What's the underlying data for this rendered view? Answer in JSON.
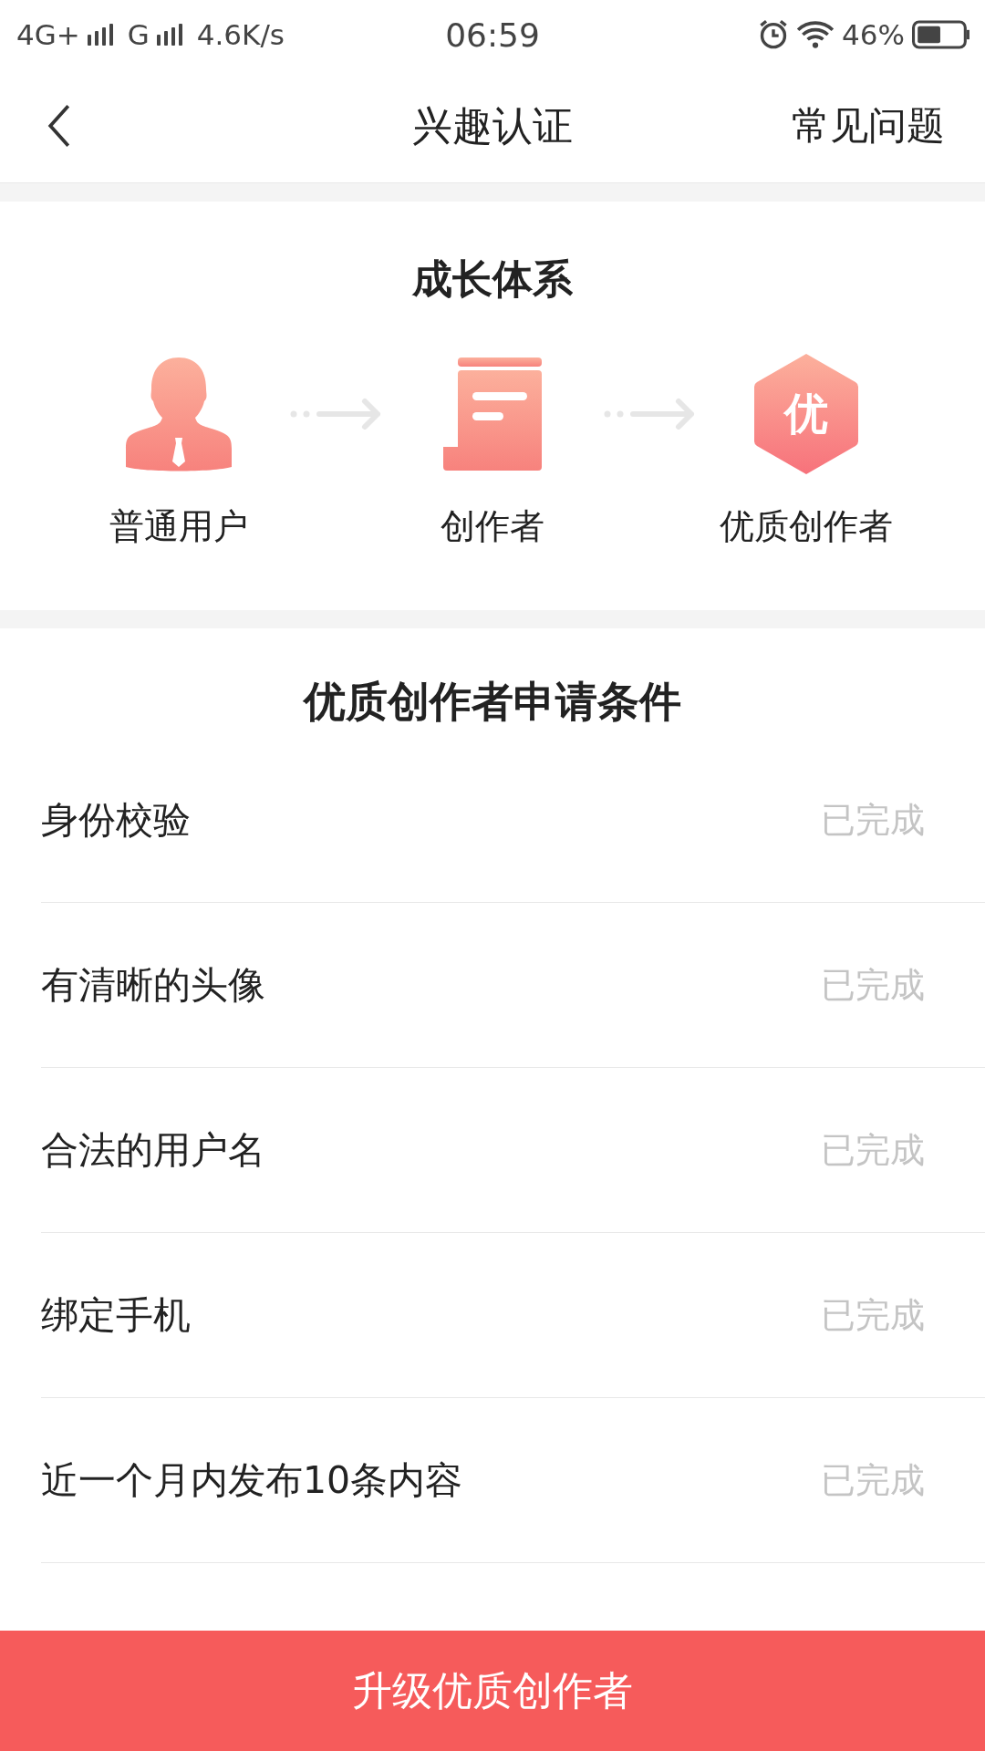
{
  "status_bar": {
    "network_1": "4G+",
    "network_2": "G",
    "speed": "4.6K/s",
    "time": "06:59",
    "battery": "46%"
  },
  "nav": {
    "title": "兴趣认证",
    "action": "常见问题"
  },
  "growth": {
    "title": "成长体系",
    "stages": [
      {
        "kind": "user",
        "label": "普通用户"
      },
      {
        "kind": "document",
        "label": "创作者"
      },
      {
        "kind": "badge",
        "label": "优质创作者",
        "badge_text": "优"
      }
    ]
  },
  "conditions": {
    "title": "优质创作者申请条件",
    "items": [
      {
        "label": "身份校验",
        "status": "已完成"
      },
      {
        "label": "有清晰的头像",
        "status": "已完成"
      },
      {
        "label": "合法的用户名",
        "status": "已完成"
      },
      {
        "label": "绑定手机",
        "status": "已完成"
      },
      {
        "label": "近一个月内发布10条内容",
        "status": "已完成"
      }
    ]
  },
  "primary_button": "升级优质创作者"
}
